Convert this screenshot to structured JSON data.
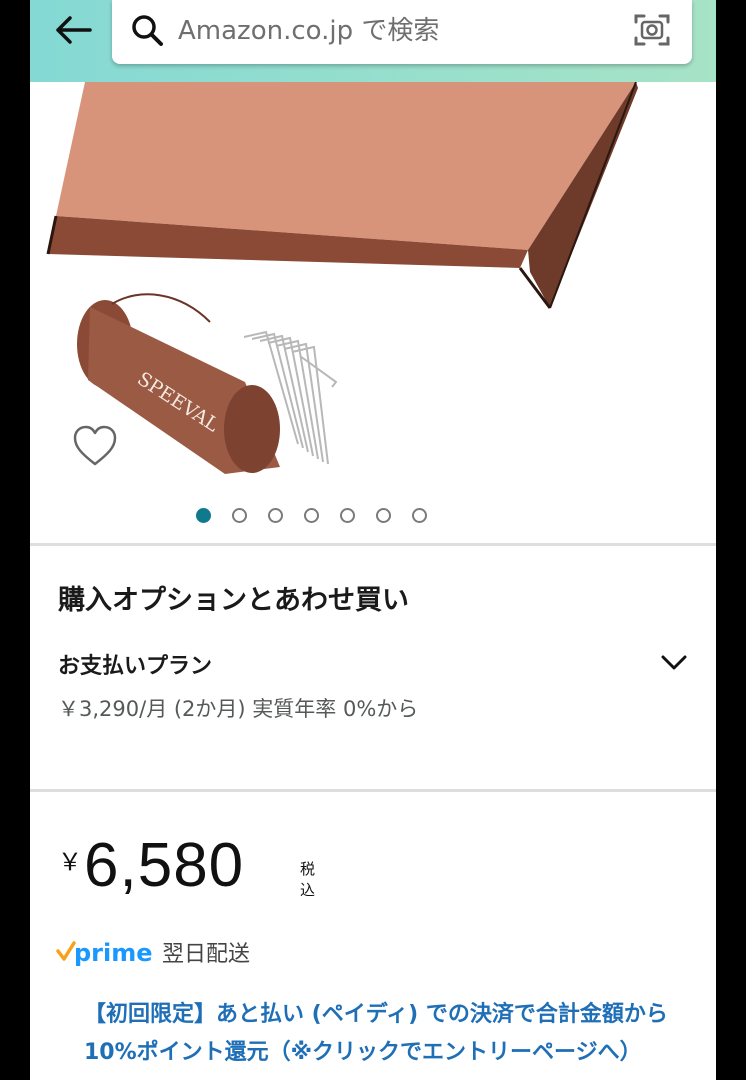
{
  "header": {
    "search_placeholder": "Amazon.co.jp で検索"
  },
  "product": {
    "brand_on_bag": "SPEEVAL",
    "carousel": {
      "total_images": 7,
      "active_index": 0
    }
  },
  "options_section": {
    "title": "購入オプションとあわせ買い",
    "payment_plan": {
      "title": "お支払いプラン",
      "detail": "￥3,290/月 (2か月) 実質年率 0%から"
    }
  },
  "price": {
    "currency": "￥",
    "amount": "6,580",
    "tax_label": "税込"
  },
  "delivery": {
    "prime_label": "prime",
    "delivery_text": "翌日配送"
  },
  "promo": {
    "text": "【初回限定】あと払い (ペイディ) での決済で合計金額から10%ポイント還元（※クリックでエントリーページへ）"
  },
  "colors": {
    "header_teal": "#84d9d4",
    "active_dot": "#0f7a8c",
    "link_blue": "#1f6fb7",
    "prime_blue": "#1a98ff",
    "prime_orange": "#f7a21b",
    "tent_rose": "#d8937b"
  }
}
